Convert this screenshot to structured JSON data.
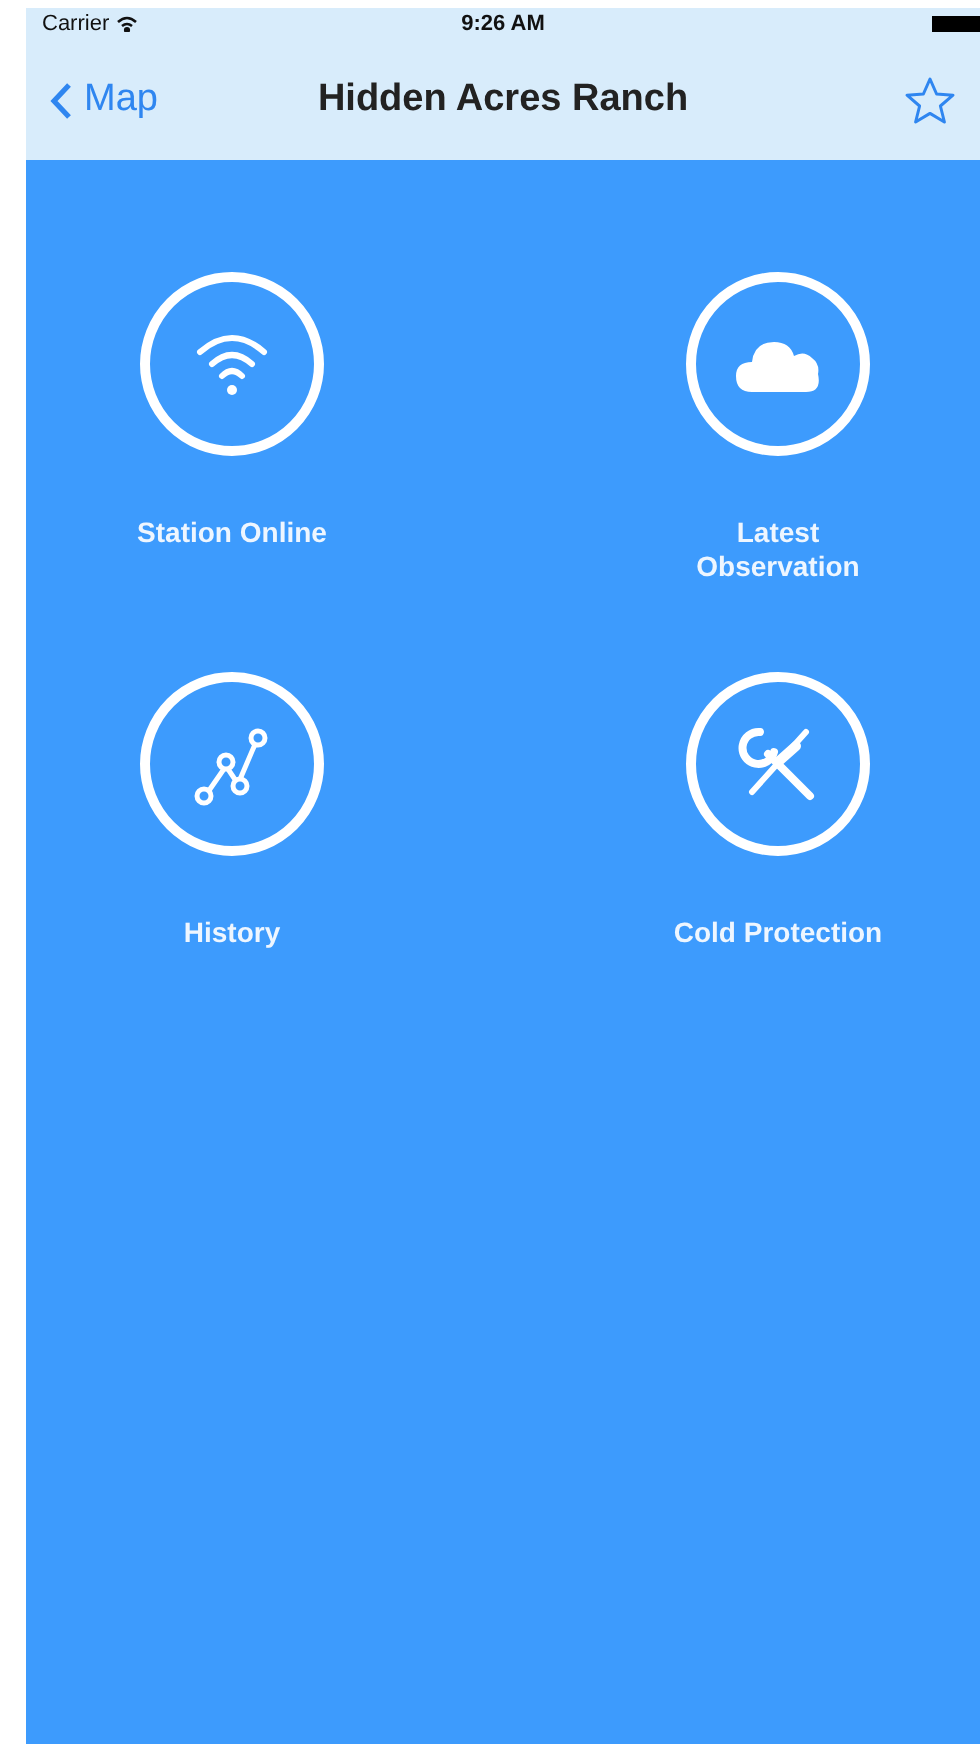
{
  "status_bar": {
    "carrier": "Carrier",
    "time": "9:26 AM"
  },
  "nav_bar": {
    "back_label": "Map",
    "title": "Hidden Acres Ranch"
  },
  "tiles": [
    {
      "label": "Station Online",
      "kind": "wifi"
    },
    {
      "label": "Latest Observation",
      "kind": "cloud"
    },
    {
      "label": "History",
      "kind": "chart"
    },
    {
      "label": "Cold Protection",
      "kind": "tools"
    }
  ]
}
